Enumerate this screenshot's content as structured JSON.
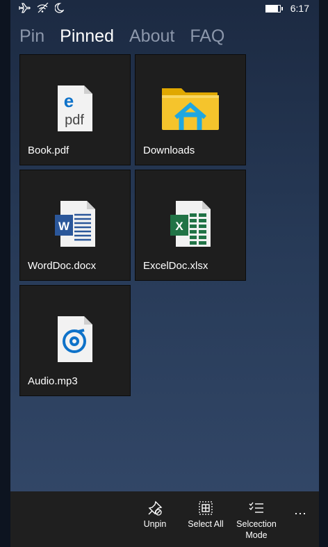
{
  "status": {
    "time": "6:17",
    "battery_level": 0.85,
    "icons": [
      "airplane-icon",
      "wifi-icon",
      "quiet-hours-icon",
      "battery-icon"
    ]
  },
  "tabs": [
    {
      "label": "Pin",
      "active": false
    },
    {
      "label": "Pinned",
      "active": true
    },
    {
      "label": "About",
      "active": false
    },
    {
      "label": "FAQ",
      "active": false
    }
  ],
  "tiles": [
    {
      "label": "Book.pdf",
      "icon": "pdf-file-icon"
    },
    {
      "label": "Downloads",
      "icon": "folder-icon"
    },
    {
      "label": "WordDoc.docx",
      "icon": "word-file-icon"
    },
    {
      "label": "ExcelDoc.xlsx",
      "icon": "excel-file-icon"
    },
    {
      "label": "Audio.mp3",
      "icon": "audio-file-icon"
    }
  ],
  "commandbar": {
    "unpin": "Unpin",
    "select_all": "Select All",
    "selection_mode_line1": "Selcection",
    "selection_mode_line2": "Mode",
    "more": "⋯"
  },
  "colors": {
    "background_top": "#1c2a42",
    "background_bottom": "#34496a",
    "tile": "#1e1e1e",
    "commandbar": "#1f1f1f",
    "tab_inactive": "#8c97ab",
    "pdf_accent": "#0e72c9",
    "word_accent": "#2b579a",
    "excel_accent": "#217346",
    "folder_yellow": "#f5c42c",
    "folder_blue": "#1fa7e1"
  }
}
